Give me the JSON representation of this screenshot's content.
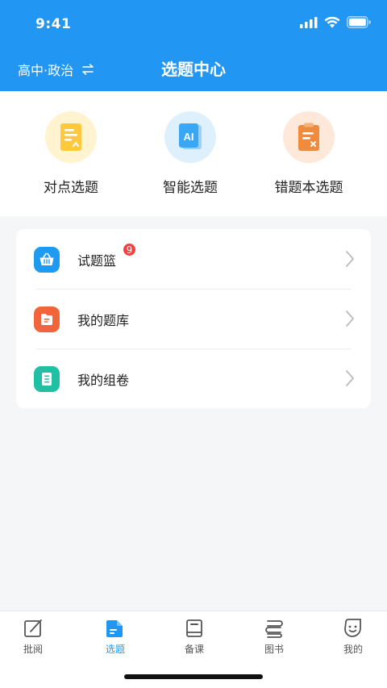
{
  "status_bar": {
    "time": "9:41"
  },
  "header": {
    "subject": "高中·政治",
    "title": "选题中心"
  },
  "quick_actions": [
    {
      "label": "对点选题",
      "icon": "document-icon",
      "color": "#ffc83d"
    },
    {
      "label": "智能选题",
      "icon": "ai-icon",
      "color": "#3aa7f5"
    },
    {
      "label": "错题本选题",
      "icon": "wrong-book-icon",
      "color": "#f08a3c"
    }
  ],
  "menu": [
    {
      "label": "试题篮",
      "icon": "basket-icon",
      "color": "#1e9bf0",
      "badge": "9"
    },
    {
      "label": "我的题库",
      "icon": "folder-icon",
      "color": "#f2653a"
    },
    {
      "label": "我的组卷",
      "icon": "paper-list-icon",
      "color": "#1fc0a4"
    }
  ],
  "tabs": [
    {
      "label": "批阅",
      "icon": "edit-icon"
    },
    {
      "label": "选题",
      "icon": "select-question-icon",
      "active": true
    },
    {
      "label": "备课",
      "icon": "book-icon"
    },
    {
      "label": "图书",
      "icon": "books-icon"
    },
    {
      "label": "我的",
      "icon": "smile-icon"
    }
  ],
  "colors": {
    "primary": "#2196f3",
    "badge": "#f5403e"
  }
}
